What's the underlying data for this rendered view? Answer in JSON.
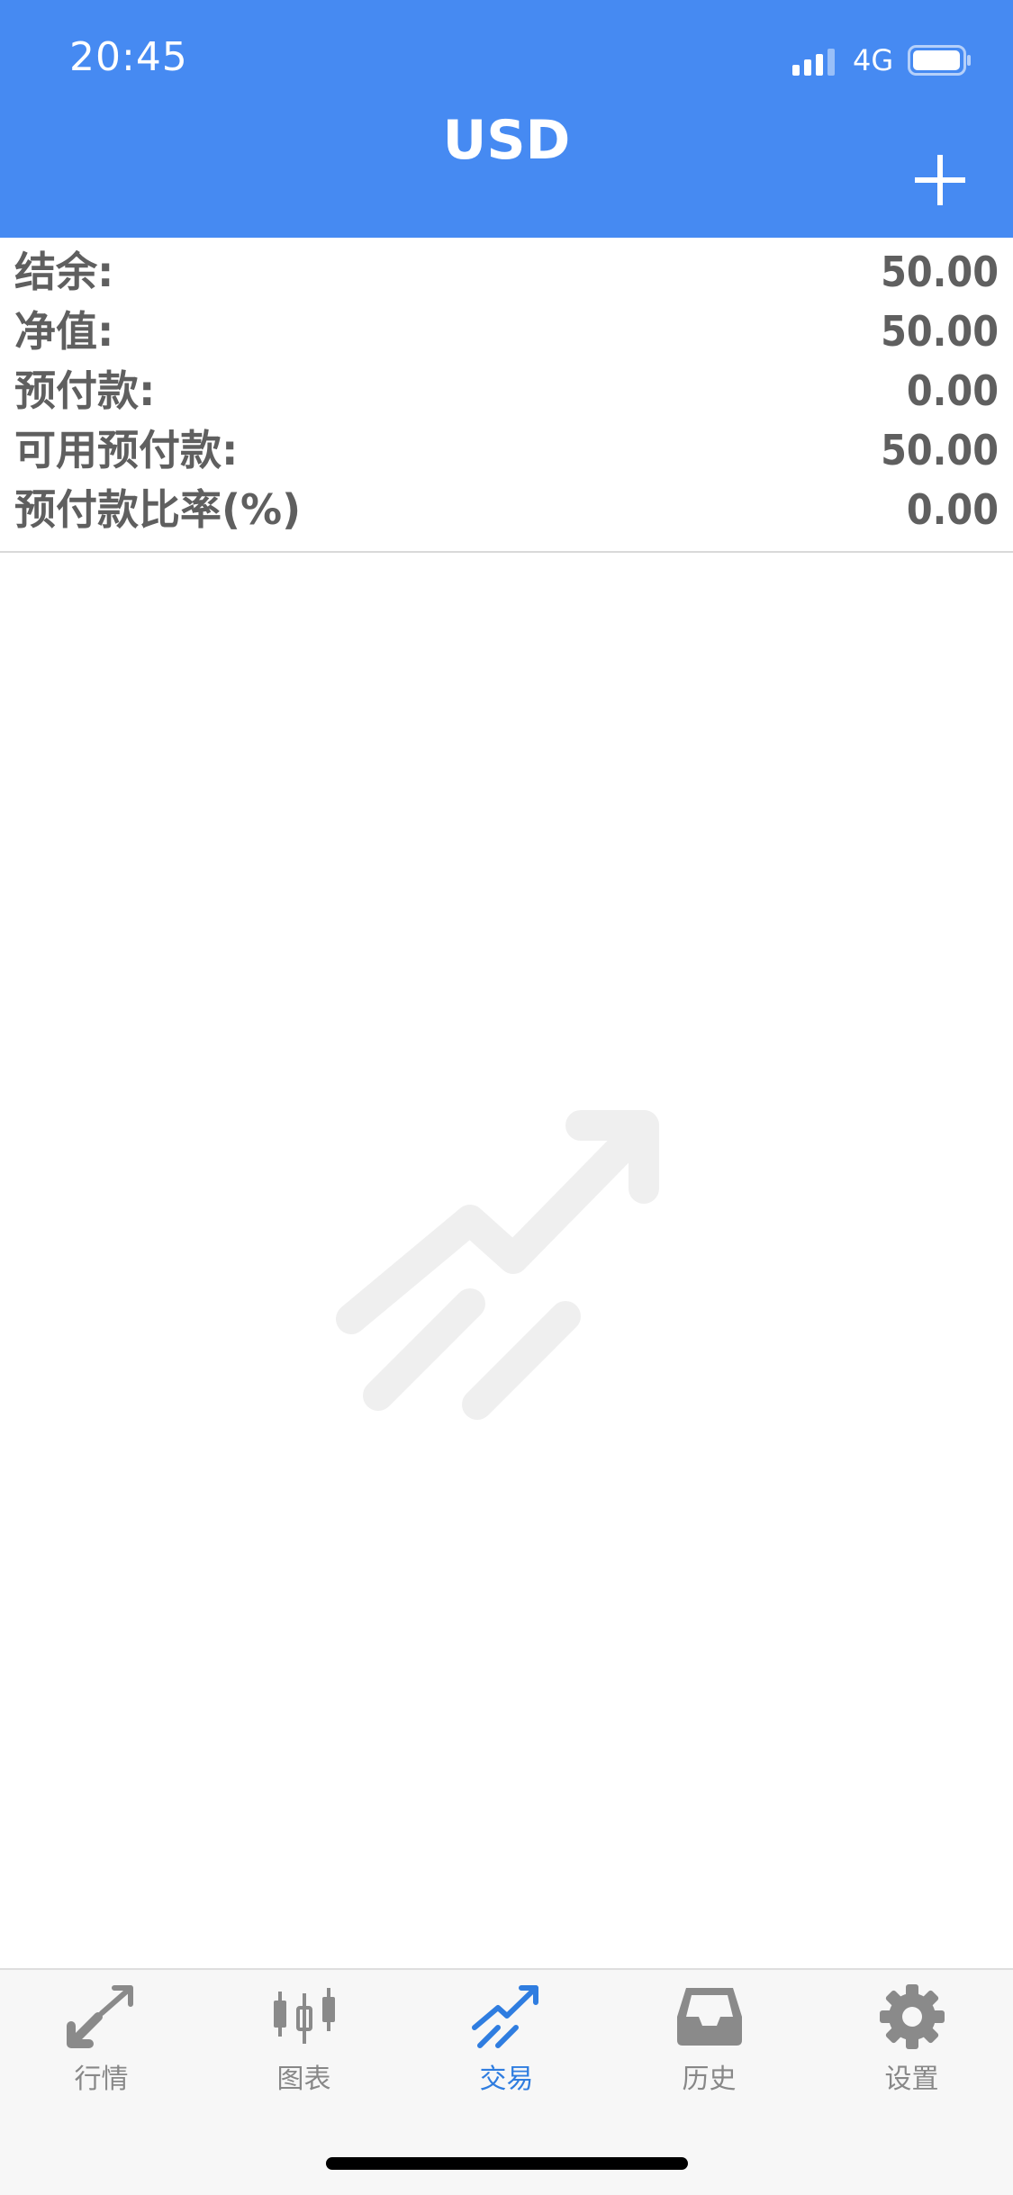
{
  "status_bar": {
    "time": "20:45",
    "network": "4G"
  },
  "header": {
    "title": "USD",
    "add_icon": "plus-icon"
  },
  "summary": [
    {
      "label": "结余:",
      "value": "50.00"
    },
    {
      "label": "净值:",
      "value": "50.00"
    },
    {
      "label": "预付款:",
      "value": "0.00"
    },
    {
      "label": "可用预付款:",
      "value": "50.00"
    },
    {
      "label": "预付款比率(%)",
      "value": "0.00"
    }
  ],
  "empty_state": {
    "icon": "trade-trend-icon"
  },
  "tabbar": {
    "accent_color": "#2f7de0",
    "items": [
      {
        "label": "行情",
        "icon": "quotes-arrows-icon",
        "active": false
      },
      {
        "label": "图表",
        "icon": "candlestick-chart-icon",
        "active": false
      },
      {
        "label": "交易",
        "icon": "trade-trend-icon",
        "active": true
      },
      {
        "label": "历史",
        "icon": "inbox-tray-icon",
        "active": false
      },
      {
        "label": "设置",
        "icon": "gear-icon",
        "active": false
      }
    ]
  }
}
